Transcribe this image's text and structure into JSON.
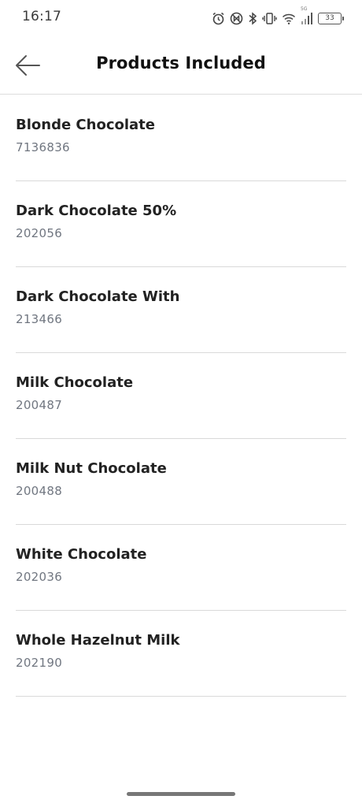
{
  "status_bar": {
    "time": "16:17",
    "network_label": "5G",
    "battery": "33",
    "icons": [
      "alarm-icon",
      "nfc-icon",
      "bluetooth-icon",
      "vibrate-icon",
      "wifi-icon",
      "signal-icon",
      "battery-icon"
    ]
  },
  "header": {
    "title": "Products Included",
    "back_icon": "arrow-left-icon"
  },
  "products": [
    {
      "name": "Blonde Chocolate",
      "code": "7136836"
    },
    {
      "name": "Dark Chocolate 50%",
      "code": "202056"
    },
    {
      "name": "Dark Chocolate With",
      "code": "213466"
    },
    {
      "name": "Milk Chocolate",
      "code": "200487"
    },
    {
      "name": "Milk Nut Chocolate",
      "code": "200488"
    },
    {
      "name": "White Chocolate",
      "code": "202036"
    },
    {
      "name": "Whole Hazelnut Milk",
      "code": "202190"
    }
  ]
}
